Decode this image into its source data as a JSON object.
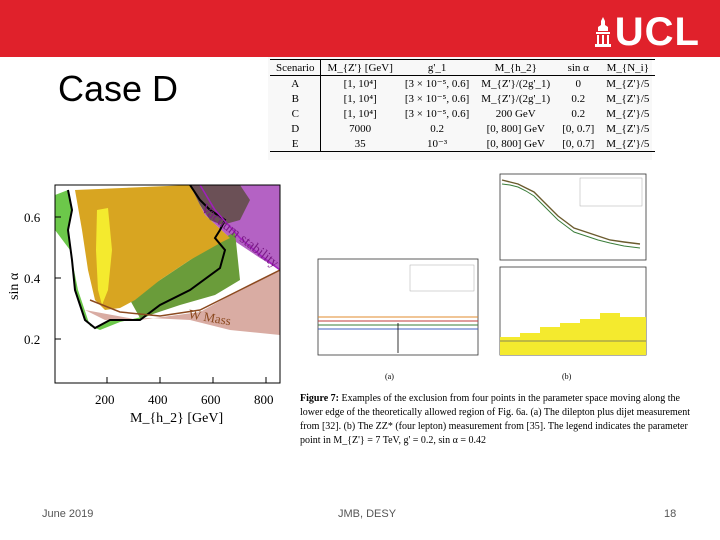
{
  "header": {
    "logo_text": "UCL"
  },
  "slide": {
    "title": "Case D"
  },
  "table": {
    "columns": [
      "Scenario",
      "M_{Z'} [GeV]",
      "g'_1",
      "M_{h_2}",
      "sin α",
      "M_{N_i}"
    ],
    "rows": [
      [
        "A",
        "[1, 10⁴]",
        "[3 × 10⁻⁵, 0.6]",
        "M_{Z'}/(2g'_1)",
        "0",
        "M_{Z'}/5"
      ],
      [
        "B",
        "[1, 10⁴]",
        "[3 × 10⁻⁵, 0.6]",
        "M_{Z'}/(2g'_1)",
        "0.2",
        "M_{Z'}/5"
      ],
      [
        "C",
        "[1, 10⁴]",
        "[3 × 10⁻⁵, 0.6]",
        "200 GeV",
        "0.2",
        "M_{Z'}/5"
      ],
      [
        "D",
        "7000",
        "0.2",
        "[0, 800] GeV",
        "[0, 0.7]",
        "M_{Z'}/5"
      ],
      [
        "E",
        "35",
        "10⁻³",
        "[0, 800] GeV",
        "[0, 0.7]",
        "M_{Z'}/5"
      ]
    ]
  },
  "main_plot": {
    "ylabel": "sin α",
    "xlabel": "M_{h_2} [GeV]",
    "yticks": [
      "0.6",
      "0.4",
      "0.2"
    ],
    "xticks": [
      "200",
      "400",
      "600",
      "800"
    ],
    "labels": {
      "vacuum": "Vacuum stability",
      "wmass": "W Mass"
    }
  },
  "chart_data": {
    "type": "area",
    "title": "",
    "xlabel": "M_{h_2} [GeV]",
    "ylabel": "sin α",
    "xlim": [
      0,
      860
    ],
    "ylim": [
      0.0,
      0.72
    ],
    "xticks": [
      200,
      400,
      600,
      800
    ],
    "yticks": [
      0.2,
      0.4,
      0.6
    ],
    "annotations": [
      "Vacuum stability",
      "W Mass"
    ],
    "regions": [
      {
        "id": "vacuum-stability-exclusion",
        "color": "#b462c4"
      },
      {
        "id": "w-mass-exclusion",
        "color": "#d9aca3"
      },
      {
        "id": "green-exclusion",
        "color": "#6cc84a"
      },
      {
        "id": "olive-exclusion",
        "color": "#6a9c3a"
      },
      {
        "id": "gold-exclusion",
        "color": "#d8a521"
      },
      {
        "id": "yellow-exclusion",
        "color": "#f4ea2e"
      },
      {
        "id": "brown-exclusion",
        "color": "#6b5056"
      }
    ]
  },
  "figure": {
    "sub_a": "(a)",
    "sub_b": "(b)",
    "caption_label": "Figure 7:",
    "caption_text": "Examples of the exclusion from four points in the parameter space moving along the lower edge of the theoretically allowed region of Fig. 6a. (a) The dilepton plus dijet measurement from [32]. (b) The ZZ* (four lepton) measurement from [35]. The legend indicates the parameter point in M_{Z'} = 7 TeV, g' = 0.2, sin α = 0.42"
  },
  "footer": {
    "date": "June 2019",
    "author": "JMB, DESY",
    "page": "18"
  }
}
